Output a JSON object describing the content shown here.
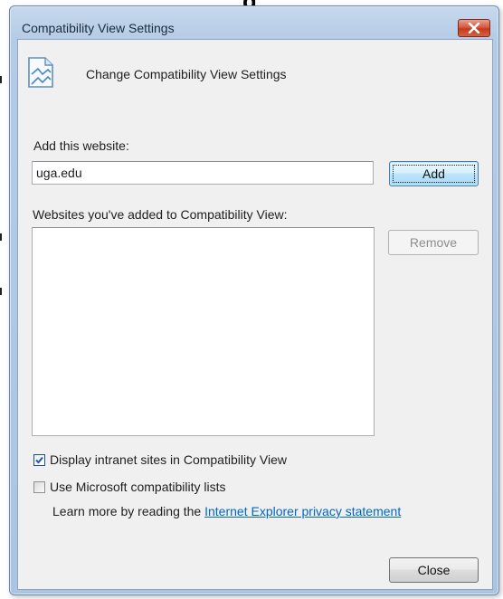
{
  "window": {
    "title": "Compatibility View Settings",
    "close_icon": "close-icon"
  },
  "background": {
    "heading_fragment": "g"
  },
  "header": {
    "icon": "compatibility-view-icon",
    "text": "Change Compatibility View Settings"
  },
  "add_section": {
    "label": "Add this website:",
    "input_value": "uga.edu",
    "add_button": "Add"
  },
  "list_section": {
    "label": "Websites you've added to Compatibility View:",
    "items": [],
    "remove_button": "Remove"
  },
  "options": {
    "intranet_label": "Display intranet sites in Compatibility View",
    "intranet_checked": true,
    "ms_lists_label": "Use Microsoft compatibility lists",
    "ms_lists_checked": false
  },
  "privacy": {
    "prefix": "Learn more by reading the ",
    "link_text": "Internet Explorer privacy statement"
  },
  "footer": {
    "close_button": "Close"
  }
}
